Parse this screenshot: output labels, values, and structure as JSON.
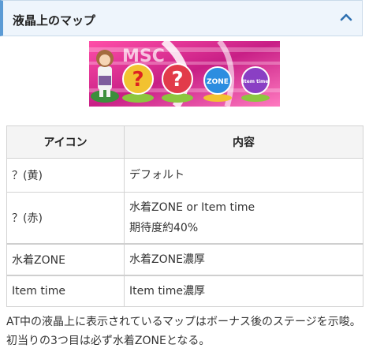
{
  "accordion": {
    "title": "液晶上のマップ",
    "toggle_icon": "chevron-up-icon"
  },
  "banner": {
    "balls": [
      {
        "label": "?",
        "color": "#f2c230"
      },
      {
        "label": "?",
        "color": "#e23b4a"
      },
      {
        "label": "ZONE",
        "color": "#2c8de0"
      },
      {
        "label": "Item time",
        "color": "#8a3fc4"
      }
    ]
  },
  "table": {
    "headers": [
      "アイコン",
      "内容"
    ],
    "rows": [
      {
        "icon": "？(黄)",
        "content": [
          "デフォルト"
        ]
      },
      {
        "icon": "？(赤)",
        "content": [
          "水着ZONE or Item time",
          "期待度約40%"
        ]
      },
      {
        "icon": "水着ZONE",
        "content": [
          "水着ZONE濃厚"
        ]
      },
      {
        "icon": "Item time",
        "content": [
          "Item time濃厚"
        ]
      }
    ]
  },
  "description": "AT中の液晶上に表示されているマップはボーナス後のステージを示唆。初当りの3つ目は必ず水着ZONEとなる。"
}
